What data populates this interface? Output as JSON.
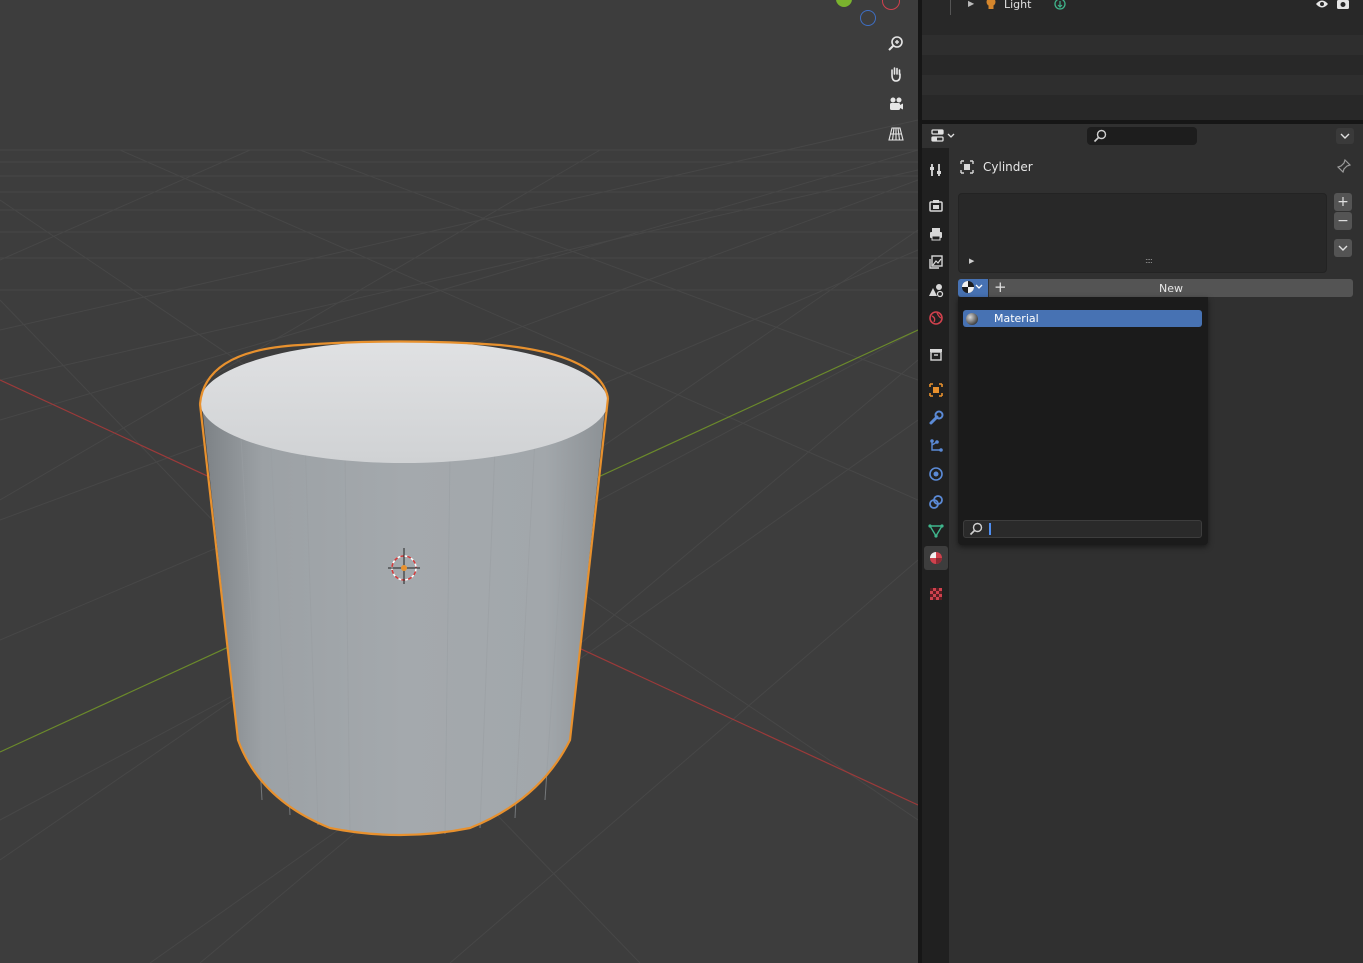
{
  "outliner": {
    "rows": [
      {
        "name": "Light",
        "type_icon": "light-bulb-icon",
        "data_icon": "light-data-icon"
      }
    ],
    "visibility_icon": "eye-icon",
    "render_icon": "camera-icon"
  },
  "properties": {
    "editor_type_icon": "properties-editor-icon",
    "search_placeholder": "",
    "object_name": "Cylinder",
    "material_slots": [],
    "new_button_label": "New",
    "tabs": [
      "tool-icon",
      "render-icon",
      "output-icon",
      "view-layer-icon",
      "scene-icon",
      "world-icon",
      "collection-icon",
      "object-icon",
      "modifier-icon",
      "particles-icon",
      "physics-icon",
      "constraints-icon",
      "object-data-icon",
      "material-icon",
      "texture-icon"
    ],
    "active_tab": "material-icon"
  },
  "material_browser": {
    "items": [
      {
        "name": "Material",
        "selected": true
      }
    ],
    "search_value": ""
  },
  "viewport": {
    "selected_object": "Cylinder",
    "navigation_buttons": [
      "zoom-icon",
      "hand-pan-icon",
      "camera-view-icon",
      "grid-perspective-icon"
    ]
  },
  "colors": {
    "selection_outline": "#e8912e",
    "active_item": "#4772b3",
    "x_axis": "#9b3a3a",
    "y_axis": "#6b8a2b",
    "gizmo_z": "#3e6fc4",
    "gizmo_y": "#7ab32e",
    "gizmo_x": "#d0414d"
  }
}
